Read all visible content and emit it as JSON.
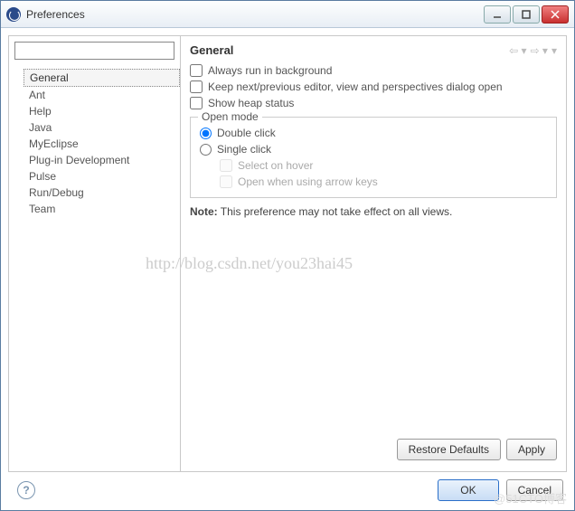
{
  "window": {
    "title": "Preferences"
  },
  "filter": {
    "value": "",
    "placeholder": ""
  },
  "tree": {
    "items": [
      {
        "label": "General",
        "selected": true
      },
      {
        "label": "Ant"
      },
      {
        "label": "Help"
      },
      {
        "label": "Java"
      },
      {
        "label": "MyEclipse"
      },
      {
        "label": "Plug-in Development"
      },
      {
        "label": "Pulse"
      },
      {
        "label": "Run/Debug"
      },
      {
        "label": "Team"
      }
    ]
  },
  "page": {
    "title": "General",
    "checks": {
      "alwaysBg": {
        "label": "Always run in background",
        "checked": false
      },
      "keepNext": {
        "label": "Keep next/previous editor, view and perspectives dialog open",
        "checked": false
      },
      "heap": {
        "label": "Show heap status",
        "checked": false
      }
    },
    "openMode": {
      "groupLabel": "Open mode",
      "double": {
        "label": "Double click",
        "selected": true
      },
      "single": {
        "label": "Single click",
        "selected": false
      },
      "selectHover": {
        "label": "Select on hover",
        "checked": false
      },
      "openArrow": {
        "label": "Open when using arrow keys",
        "checked": false
      }
    },
    "noteLabel": "Note:",
    "noteText": " This preference may not take effect on all views."
  },
  "buttons": {
    "restore": "Restore Defaults",
    "apply": "Apply",
    "ok": "OK",
    "cancel": "Cancel"
  },
  "watermark": "http://blog.csdn.net/you23hai45",
  "watermark2": "@51CTO博客"
}
